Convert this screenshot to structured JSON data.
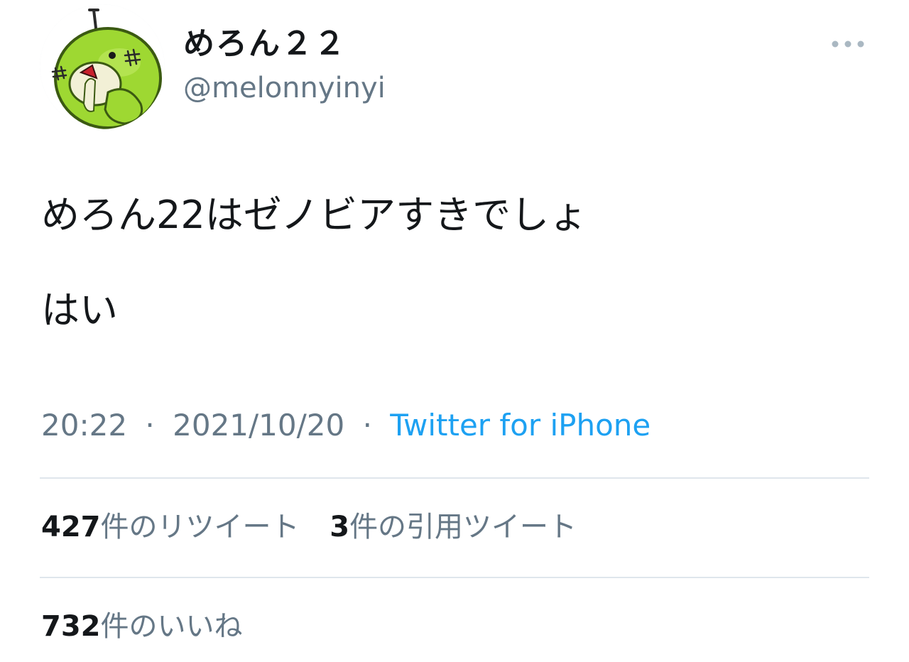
{
  "user": {
    "display_name": "めろん２２",
    "handle": "@melonnyinyi",
    "avatar_icon": "melon-character-avatar"
  },
  "more_icon": "more-horizontal-icon",
  "tweet": {
    "lines": [
      "めろん22はゼノビアすきでしょ",
      "はい"
    ],
    "time": "20:22",
    "separator": "·",
    "date": "2021/10/20",
    "source": "Twitter for iPhone"
  },
  "stats": {
    "retweets": {
      "count": "427",
      "label": "件のリツイート"
    },
    "quotes": {
      "count": "3",
      "label": "件の引用ツイート"
    },
    "likes": {
      "count": "732",
      "label": "件のいいね"
    }
  },
  "colors": {
    "text": "#14171a",
    "secondary": "#657786",
    "link": "#1da1f2",
    "divider": "#dfe6ec"
  }
}
